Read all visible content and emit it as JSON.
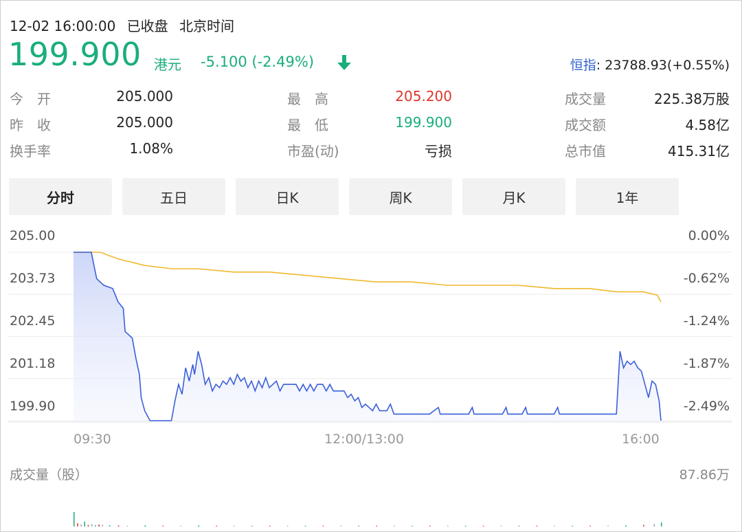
{
  "header": {
    "datetime": "12-02 16:00:00",
    "status": "已收盘",
    "timezone": "北京时间",
    "price": "199.900",
    "currency": "港元",
    "change": "-5.100 (-2.49%)",
    "index_name": "恒指",
    "index_value": ": 23788.93(+0.55%)",
    "colors": {
      "down": "#1aae7a",
      "up": "#e0352b",
      "index": "#2d5fd1"
    }
  },
  "stats": [
    [
      {
        "label": "今　开",
        "value": "205.000"
      },
      {
        "label": "最　高",
        "value": "205.200",
        "tone": "up"
      },
      {
        "label": "成交量",
        "value": "225.38万股"
      }
    ],
    [
      {
        "label": "昨　收",
        "value": "205.000"
      },
      {
        "label": "最　低",
        "value": "199.900",
        "tone": "down"
      },
      {
        "label": "成交额",
        "value": "4.58亿"
      }
    ],
    [
      {
        "label": "换手率",
        "value": "1.08%"
      },
      {
        "label": "市盈(动)",
        "value": "亏损"
      },
      {
        "label": "总市值",
        "value": "415.31亿"
      }
    ]
  ],
  "tabs": [
    "分时",
    "五日",
    "日K",
    "周K",
    "月K",
    "1年"
  ],
  "active_tab": "分时",
  "volume_label": "成交量（股）",
  "volume_max_label": "87.86万",
  "chart_data": {
    "type": "line",
    "y_ticks": [
      "205.00",
      "203.73",
      "202.45",
      "201.18",
      "199.90"
    ],
    "y_pct_ticks": [
      "0.00%",
      "-0.62%",
      "-1.24%",
      "-1.87%",
      "-2.49%"
    ],
    "x_ticks": [
      "09:30",
      "12:00/13:00",
      "16:00"
    ],
    "ylim": [
      199.9,
      205.0
    ],
    "x_range": [
      0,
      330
    ],
    "series": [
      {
        "color": "#3a5fd9",
        "fill": true,
        "points": [
          [
            0,
            205.0
          ],
          [
            10,
            205.0
          ],
          [
            13,
            204.2
          ],
          [
            17,
            204.0
          ],
          [
            22,
            203.9
          ],
          [
            25,
            203.5
          ],
          [
            28,
            203.3
          ],
          [
            29,
            202.6
          ],
          [
            33,
            202.4
          ],
          [
            35,
            201.8
          ],
          [
            37,
            201.3
          ],
          [
            38,
            200.6
          ],
          [
            40,
            200.2
          ],
          [
            43,
            199.9
          ],
          [
            55,
            199.9
          ],
          [
            57,
            200.5
          ],
          [
            59,
            201.0
          ],
          [
            61,
            200.7
          ],
          [
            63,
            201.5
          ],
          [
            65,
            201.1
          ],
          [
            67,
            201.6
          ],
          [
            68,
            201.3
          ],
          [
            70,
            202.0
          ],
          [
            72,
            201.6
          ],
          [
            74,
            201.0
          ],
          [
            76,
            201.2
          ],
          [
            78,
            200.8
          ],
          [
            80,
            201.0
          ],
          [
            82,
            200.9
          ],
          [
            84,
            201.1
          ],
          [
            86,
            201.0
          ],
          [
            88,
            201.2
          ],
          [
            90,
            201.0
          ],
          [
            92,
            201.3
          ],
          [
            94,
            201.1
          ],
          [
            96,
            201.2
          ],
          [
            98,
            200.9
          ],
          [
            100,
            201.1
          ],
          [
            102,
            200.8
          ],
          [
            104,
            201.1
          ],
          [
            106,
            200.9
          ],
          [
            108,
            201.2
          ],
          [
            110,
            200.9
          ],
          [
            112,
            201.0
          ],
          [
            114,
            201.1
          ],
          [
            116,
            200.8
          ],
          [
            118,
            201.0
          ],
          [
            125,
            201.0
          ],
          [
            127,
            200.8
          ],
          [
            129,
            201.0
          ],
          [
            131,
            200.8
          ],
          [
            133,
            201.0
          ],
          [
            135,
            200.8
          ],
          [
            137,
            201.0
          ],
          [
            140,
            201.0
          ],
          [
            142,
            200.8
          ],
          [
            144,
            201.0
          ],
          [
            146,
            200.8
          ],
          [
            148,
            200.8
          ],
          [
            150,
            200.8
          ],
          [
            152,
            200.8
          ],
          [
            154,
            200.6
          ],
          [
            156,
            200.7
          ],
          [
            158,
            200.5
          ],
          [
            160,
            200.6
          ],
          [
            162,
            200.3
          ],
          [
            164,
            200.4
          ],
          [
            168,
            200.2
          ],
          [
            170,
            200.4
          ],
          [
            172,
            200.2
          ],
          [
            176,
            200.2
          ],
          [
            178,
            200.4
          ],
          [
            180,
            200.1
          ],
          [
            184,
            200.1
          ],
          [
            186,
            200.1
          ],
          [
            200,
            200.1
          ],
          [
            205,
            200.3
          ],
          [
            206,
            200.1
          ],
          [
            222,
            200.1
          ],
          [
            224,
            200.3
          ],
          [
            225,
            200.1
          ],
          [
            241,
            200.1
          ],
          [
            243,
            200.3
          ],
          [
            244,
            200.1
          ],
          [
            252,
            200.1
          ],
          [
            254,
            200.3
          ],
          [
            255,
            200.1
          ],
          [
            270,
            200.1
          ],
          [
            272,
            200.3
          ],
          [
            273,
            200.1
          ],
          [
            305,
            200.1
          ],
          [
            307,
            202.0
          ],
          [
            309,
            201.5
          ],
          [
            311,
            201.7
          ],
          [
            313,
            201.6
          ],
          [
            315,
            201.7
          ],
          [
            317,
            201.5
          ],
          [
            319,
            201.4
          ],
          [
            321,
            201.0
          ],
          [
            323,
            200.6
          ],
          [
            325,
            201.1
          ],
          [
            327,
            201.0
          ],
          [
            329,
            200.5
          ],
          [
            330,
            199.9
          ]
        ]
      },
      {
        "color": "#f0b92d",
        "fill": false,
        "points": [
          [
            0,
            205.0
          ],
          [
            15,
            205.0
          ],
          [
            25,
            204.8
          ],
          [
            40,
            204.6
          ],
          [
            55,
            204.5
          ],
          [
            70,
            204.5
          ],
          [
            90,
            204.4
          ],
          [
            110,
            204.4
          ],
          [
            130,
            204.3
          ],
          [
            150,
            204.2
          ],
          [
            170,
            204.1
          ],
          [
            190,
            204.1
          ],
          [
            210,
            204.0
          ],
          [
            230,
            204.0
          ],
          [
            250,
            204.0
          ],
          [
            270,
            203.9
          ],
          [
            290,
            203.9
          ],
          [
            305,
            203.8
          ],
          [
            320,
            203.8
          ],
          [
            328,
            203.7
          ],
          [
            330,
            203.5
          ]
        ]
      }
    ],
    "volume": {
      "max": "87.86万",
      "series": [
        [
          0,
          0.35
        ],
        [
          2,
          0.08
        ],
        [
          4,
          0.05
        ],
        [
          6,
          0.12
        ],
        [
          8,
          0.04
        ],
        [
          10,
          0.06
        ],
        [
          12,
          0.03
        ],
        [
          14,
          0.05
        ],
        [
          16,
          0.04
        ],
        [
          20,
          0.03
        ],
        [
          25,
          0.03
        ],
        [
          30,
          0.02
        ],
        [
          40,
          0.03
        ],
        [
          50,
          0.02
        ],
        [
          60,
          0.02
        ],
        [
          70,
          0.03
        ],
        [
          80,
          0.02
        ],
        [
          90,
          0.02
        ],
        [
          100,
          0.02
        ],
        [
          110,
          0.02
        ],
        [
          120,
          0.02
        ],
        [
          130,
          0.02
        ],
        [
          140,
          0.02
        ],
        [
          150,
          0.02
        ],
        [
          160,
          0.02
        ],
        [
          170,
          0.02
        ],
        [
          180,
          0.02
        ],
        [
          190,
          0.02
        ],
        [
          200,
          0.02
        ],
        [
          210,
          0.02
        ],
        [
          220,
          0.02
        ],
        [
          230,
          0.02
        ],
        [
          240,
          0.02
        ],
        [
          250,
          0.02
        ],
        [
          260,
          0.02
        ],
        [
          270,
          0.02
        ],
        [
          280,
          0.02
        ],
        [
          290,
          0.02
        ],
        [
          300,
          0.02
        ],
        [
          310,
          0.03
        ],
        [
          320,
          0.04
        ],
        [
          326,
          0.06
        ],
        [
          330,
          0.1
        ]
      ]
    }
  }
}
